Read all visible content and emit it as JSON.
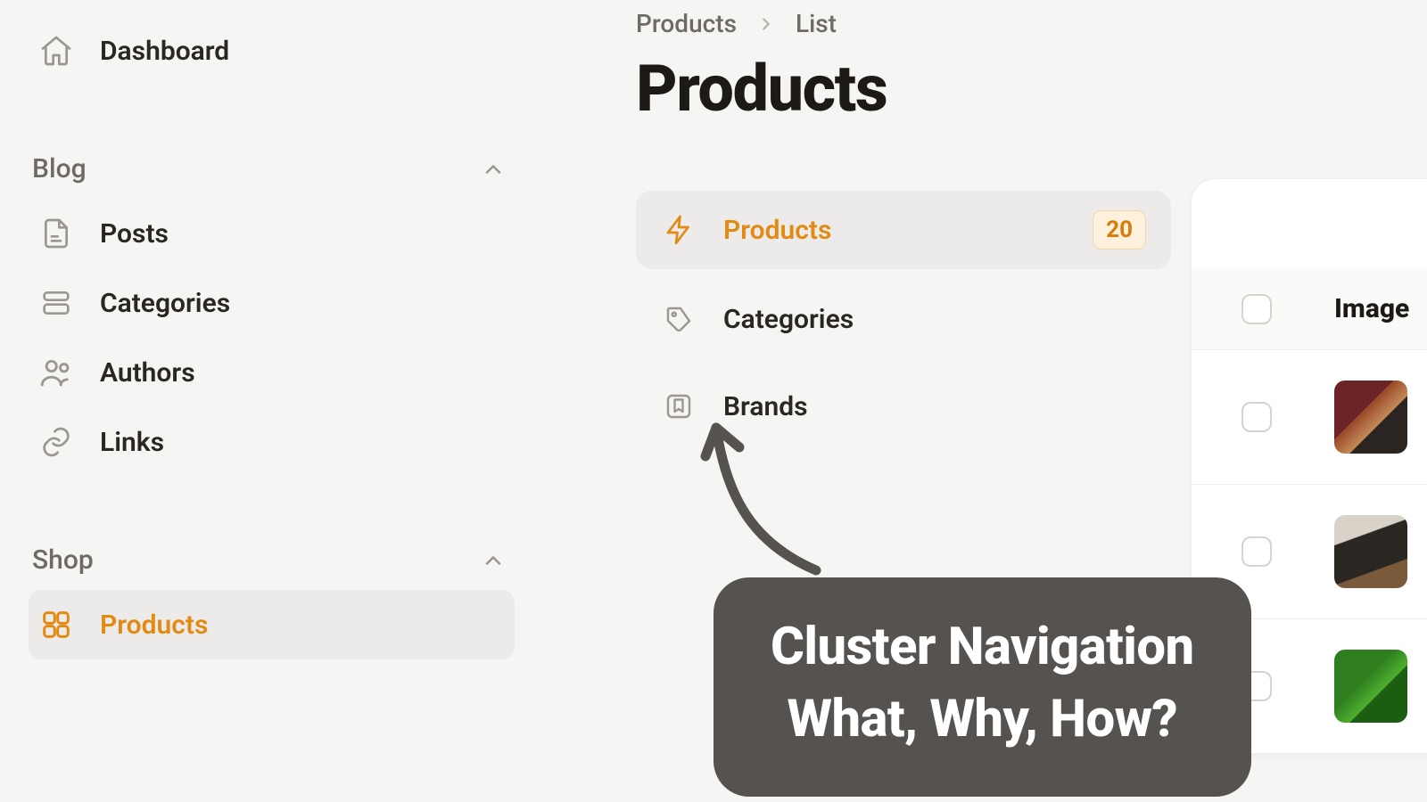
{
  "sidebar": {
    "dashboard_label": "Dashboard",
    "groups": [
      {
        "title": "Blog",
        "items": [
          {
            "label": "Posts"
          },
          {
            "label": "Categories"
          },
          {
            "label": "Authors"
          },
          {
            "label": "Links"
          }
        ]
      },
      {
        "title": "Shop",
        "items": [
          {
            "label": "Products"
          }
        ]
      }
    ]
  },
  "breadcrumb": {
    "parent": "Products",
    "current": "List"
  },
  "page": {
    "title": "Products"
  },
  "cluster": {
    "items": [
      {
        "label": "Products",
        "badge": "20"
      },
      {
        "label": "Categories"
      },
      {
        "label": "Brands"
      }
    ]
  },
  "table": {
    "columns": [
      "Image"
    ]
  },
  "annotation": {
    "line1": "Cluster Navigation",
    "line2": "What, Why, How?"
  },
  "colors": {
    "accent": "#e28b14",
    "badge_bg": "#fdf1de",
    "annotation_bg": "#55524f"
  }
}
